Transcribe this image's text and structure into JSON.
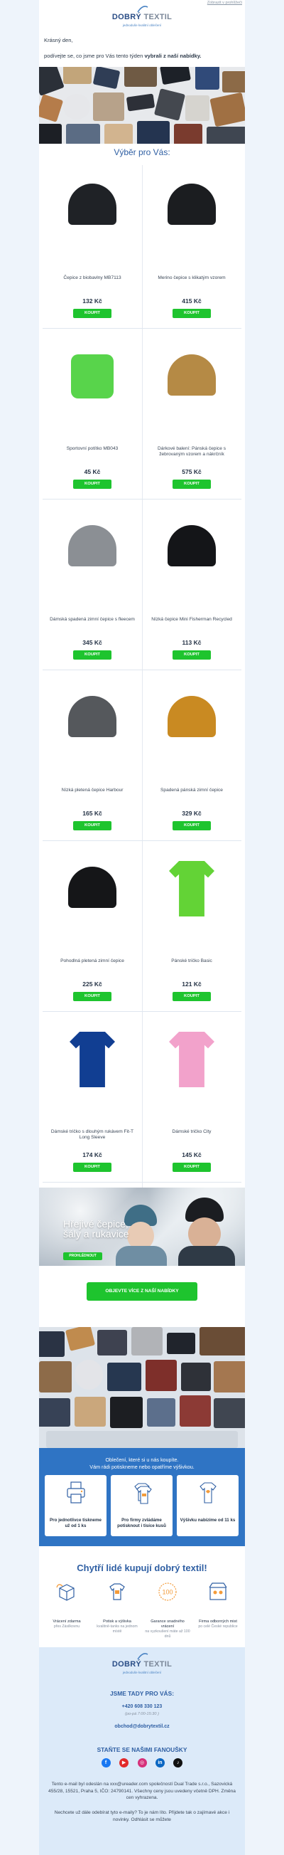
{
  "header": {
    "web_link": "Zobrazit v prohlížeči",
    "brand_main": "DOBRÝ",
    "brand_accent": "TEXTIL",
    "tagline": "jednoduše kvalitní oblečení"
  },
  "greeting": "Krásný den,",
  "intro": {
    "lead": "podívejte se, co jsme pro Vás tento týden",
    "bold": "vybrali z naší nabídky."
  },
  "section_title": "Výběr pro Vás:",
  "currency": "Kč",
  "buy_label": "KOUPIT",
  "products": [
    {
      "name": "Čepice z biobavlny MB7113",
      "price": "132 Kč",
      "color": "#1f2226"
    },
    {
      "name": "Merino čepice s klikatým vzorem",
      "price": "415 Kč",
      "color": "#1b1d20"
    },
    {
      "name": "Sportovní potítko MB043",
      "price": "45 Kč",
      "color": "#58d44b"
    },
    {
      "name": "Dárkové balení: Pánská čepice s žebrovaným vzorem a nákrčník",
      "price": "575 Kč",
      "color": "#b58a45"
    },
    {
      "name": "Dámská spadená zimní čepice s fleecem",
      "price": "345 Kč",
      "color": "#8b8f94"
    },
    {
      "name": "Nízká čepice Mini Fisherman Recycled",
      "price": "113 Kč",
      "color": "#141518"
    },
    {
      "name": "Nízká pletená čepice Harbour",
      "price": "165 Kč",
      "color": "#55585c"
    },
    {
      "name": "Spadená pánská zimní čepice",
      "price": "329 Kč",
      "color": "#c98a22"
    },
    {
      "name": "Pohodlná pletená zimní čepice",
      "price": "225 Kč",
      "color": "#151618"
    },
    {
      "name": "Pánské tričko Basic",
      "price": "121 Kč",
      "color": "#63d336"
    },
    {
      "name": "Dámské tričko s dlouhým rukávem Fit-T Long Sleeve",
      "price": "174 Kč",
      "color": "#113e92"
    },
    {
      "name": "Dámské tričko City",
      "price": "145 Kč",
      "color": "#f2a2cb"
    }
  ],
  "winter_banner": {
    "line1": "Hřejivé čepice,",
    "line2": "šály a rukavice",
    "button": "PROHLÉDNOUT"
  },
  "more_button": "OBJEVTE VÍCE Z NAŠÍ NABÍDKY",
  "benefits": {
    "line1": "Oblečení, které si u nás koupíte.",
    "line2": "Vám rádi potiskneme nebo opatříme výšivkou.",
    "cards": [
      {
        "label": "Pro jednotlivce tiskneme už od 1 ks",
        "icon": "printer-icon"
      },
      {
        "label": "Pro firmy zvládáme potisknout i tisíce kusů",
        "icon": "tshirt-stack-icon"
      },
      {
        "label": "Výšivku nabízíme od 11 ks",
        "icon": "embroidered-shirt-icon"
      }
    ]
  },
  "smart_title": "Chytří lidé kupují dobrý textil!",
  "features": [
    {
      "title": "Vrácení zdarma",
      "sub": "přes Zásilkovnu",
      "icon": "return-box-icon"
    },
    {
      "title": "Potisk a výšivka",
      "sub": "kvalitně-tanks na jednom místě",
      "icon": "shirt-print-icon"
    },
    {
      "title": "Garance snadného vrácení",
      "sub": "na vyzkoušení máte až 100 dnů",
      "icon": "guarantee-100-icon"
    },
    {
      "title": "Firma odborných mist",
      "sub": "po celé České republice",
      "icon": "store-people-icon"
    }
  ],
  "footer": {
    "here_title": "JSME TADY PRO VÁS:",
    "phone": "+420 608 330 123",
    "hours": "(po-pá 7:00-15:30 )",
    "email": "obchod@dobrytextil.cz",
    "fans_title": "STAŇTE SE NAŠIMI FANOUŠKY",
    "legal": "Tento e-mail byl odeslán na xxx@ureader.com společností Dual Trade s.r.o., Sazovická 455/28, 15521, Praha 5, IČO: 24790141. Všechny ceny jsou uvedeny včetně DPH. Změna cen vyhrazena.",
    "unsubscribe": "Nechcete už dále odebírat tyto e-maily? To je nám líto. Přijdete tak o zajímavé akce i novinky. Odhlásit se můžete"
  },
  "colors": {
    "accent": "#2f5fa3",
    "buy": "#1ec42e",
    "benefit_bg": "#2f74c4",
    "footer_bg": "#dceaf9",
    "page_bg": "#eef4fb"
  }
}
